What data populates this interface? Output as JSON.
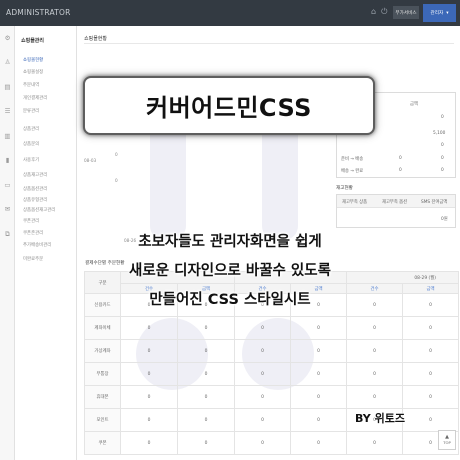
{
  "header": {
    "brand": "ADMINISTRATOR",
    "service_btn": "부가서비스",
    "admin_btn": "관리자",
    "admin_caret": "▾",
    "icons": [
      "home-icon",
      "logout-icon"
    ]
  },
  "iconbar": {
    "icons": [
      "gear-icon",
      "user-icon",
      "doc-icon",
      "list-icon",
      "bars-icon",
      "chart-icon",
      "chat-icon",
      "mail-icon",
      "copy-icon"
    ]
  },
  "sidebar": {
    "title": "쇼핑몰관리",
    "items": [
      "쇼핑몰현황",
      "쇼핑몰설정",
      "주문내역",
      "개인결제관리",
      "분류관리",
      "상품관리",
      "상품문의",
      "사용후기",
      "상품재고관리",
      "상품옵션관리",
      "상품유형관리",
      "상품옵션재고관리",
      "쿠폰관리",
      "쿠폰존관리",
      "추가배송비관리",
      "미완료주문"
    ]
  },
  "main": {
    "page_title": "쇼핑몰현황",
    "bg_label_date": "08-03",
    "bg_label_date2": "08-26",
    "bg_zero_a": "0",
    "bg_zero_b": "0",
    "right_panel": {
      "col_header": "금액",
      "val1": "0",
      "val2": "5,100",
      "val3": "0",
      "row_a_label": "준비 → 배송",
      "row_a_v1": "0",
      "row_a_v2": "0",
      "row_b_label": "배송 → 완료",
      "row_b_v1": "0",
      "row_b_v2": "0",
      "stock_title": "재고현황",
      "stock_h1": "재고부족 상품",
      "stock_h2": "재고부족 옵션",
      "stock_h3": "SMS 잔여금액",
      "stock_v3": "0원"
    },
    "stats": {
      "title": "결제수단별 주문현황",
      "row_header": "구분",
      "date_header": "08-29 (월)",
      "count_label": "건수",
      "amount_label": "금액",
      "rows": [
        {
          "label": "신용카드",
          "values": [
            "0",
            "0",
            "0",
            "0",
            "0",
            "0"
          ]
        },
        {
          "label": "계좌이체",
          "values": [
            "0",
            "0",
            "0",
            "0",
            "0",
            "0"
          ]
        },
        {
          "label": "가상계좌",
          "values": [
            "0",
            "0",
            "0",
            "0",
            "0",
            "0"
          ]
        },
        {
          "label": "무통장",
          "values": [
            "0",
            "0",
            "0",
            "0",
            "0",
            "0"
          ]
        },
        {
          "label": "휴대폰",
          "values": [
            "0",
            "0",
            "0",
            "0",
            "0",
            "0"
          ]
        },
        {
          "label": "포인트",
          "values": [
            "0",
            "0",
            "0",
            "0",
            "0",
            "0"
          ]
        },
        {
          "label": "쿠폰",
          "values": [
            "0",
            "0",
            "0",
            "0",
            "0",
            "0"
          ]
        }
      ]
    }
  },
  "overlay": {
    "banner_title": "커버어드민CSS",
    "line1": "초보자들도 관리자화면을 쉽게",
    "line2": "새로운 디자인으로 바꿀수 있도록",
    "line3": "만들어진 CSS 스타일시트",
    "byline": "BY 위토즈"
  },
  "top_button": {
    "arrow": "▲",
    "label": "TOP"
  }
}
